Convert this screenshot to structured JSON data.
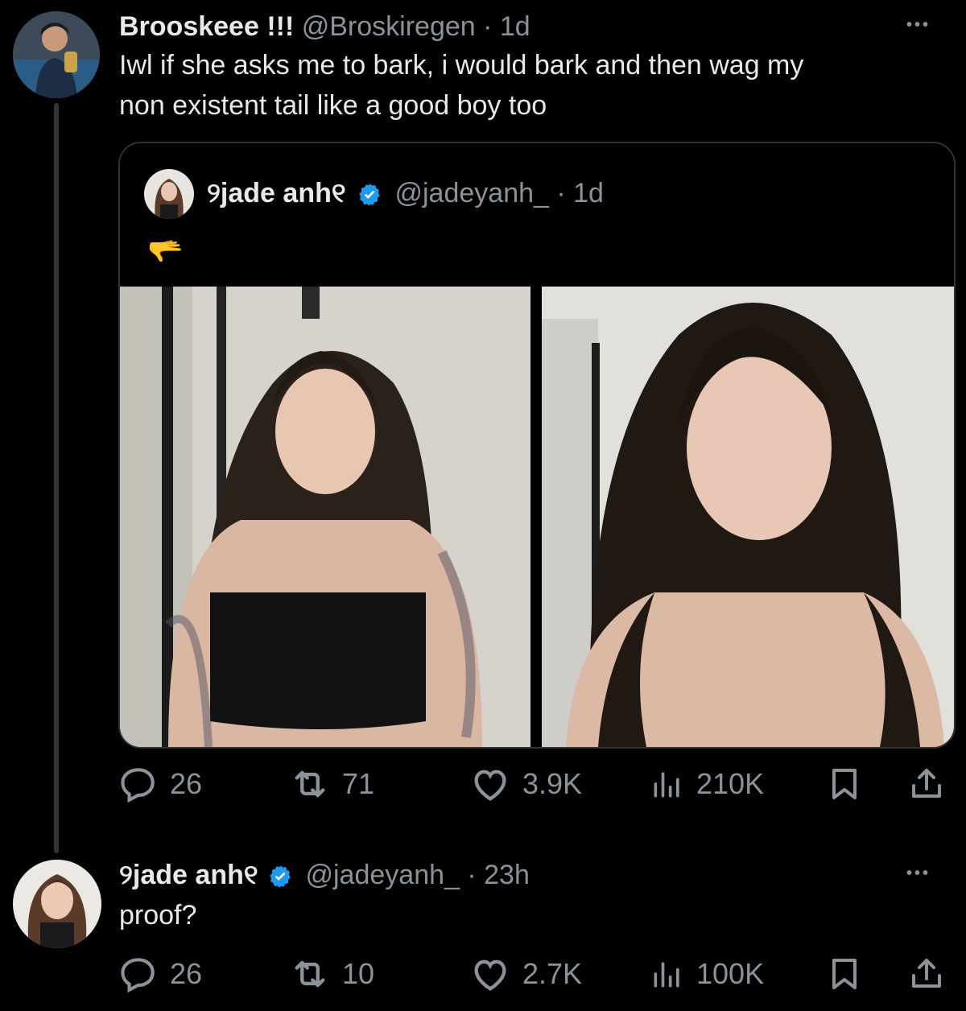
{
  "tweet1": {
    "display_name": "Brooskeee !!!",
    "handle": "@Broskiregen",
    "time": "· 1d",
    "more": "•••",
    "text_line1": "Iwl if she asks me to bark, i would bark and then wag my",
    "text_line2": "non existent tail like a good boy too",
    "quote": {
      "display_name": "୨jade anh୧",
      "handle": "@jadeyanh_",
      "time": "· 1d",
      "emoji": "🫳"
    },
    "stats": {
      "replies": "26",
      "reposts": "71",
      "likes": "3.9K",
      "views": "210K"
    }
  },
  "tweet2": {
    "display_name": "୨jade anh୧",
    "handle": "@jadeyanh_",
    "time": "· 23h",
    "more": "•••",
    "text": "proof?",
    "stats": {
      "replies": "26",
      "reposts": "10",
      "likes": "2.7K",
      "views": "100K"
    }
  },
  "colors": {
    "background": "#000000",
    "text": "#e7e9ea",
    "muted": "#8b9299",
    "verified": "#1d9bf0",
    "border": "#2f3336"
  }
}
